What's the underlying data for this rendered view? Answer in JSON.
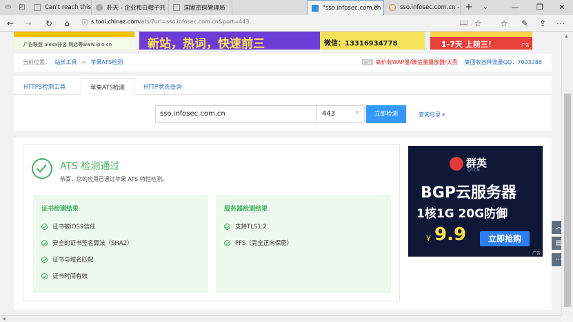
{
  "tabs": [
    {
      "title": "Can't reach this page"
    },
    {
      "title": "朴天 - 企业和白帽子共"
    },
    {
      "title": "国家密码管理局"
    },
    {
      "title": "\"sso.infosec.com.cn"
    },
    {
      "title": "sso.infosec.com.cn - SS"
    }
  ],
  "address": {
    "host": "s.tool.chinaz.com",
    "path": "/ats/?url=sso.infosec.com.cn&port=443"
  },
  "banners": {
    "left_text": "广告联盟 alexa排名 网店等www.iplo.cn",
    "middle_big": "新站，热词，快速前三",
    "middle_contact": "微信：13316934778",
    "right_big": "1-7天 上前三！",
    "right_tag": "广告"
  },
  "breadcrumb": {
    "prefix": "当前位置：",
    "home": "站长工具",
    "sep": ">",
    "current": "苹果ATS检测"
  },
  "promo": {
    "badge": "广告",
    "text1": "高价收WAP量/微信量播放器/大秀",
    "text2": "集团收各种流量QQ：7003288"
  },
  "tool_tabs": [
    "HTTPS检测工具",
    "苹果ATS检测",
    "HTTP状态查询"
  ],
  "search": {
    "host": "sso.infosec.com.cn",
    "port": "443",
    "button": "立即检测",
    "history": "查询记录"
  },
  "result": {
    "title": "ATS 检测通过",
    "subtitle": "恭喜，您的应用已通过苹果 ATS 特性检测。",
    "cert_title": "证书检测结果",
    "cert_items": [
      "证书被iOS9信任",
      "安全的证书签名算法（SHA2）",
      "证书与域名匹配",
      "证书时间有效"
    ],
    "server_title": "服务器检测结果",
    "server_items": [
      "支持TLS1.2",
      "PFS（完全正向保密）"
    ]
  },
  "ad": {
    "brand": "群英",
    "brand_sub": "QY.CN",
    "line1": "BGP云服务器",
    "line2": "1核1G 20G防御",
    "price_symbol": "¥",
    "price": "9.9",
    "cta": "立即抢购",
    "tag": "广告"
  },
  "colors": {
    "accent": "#3399ff",
    "success": "#45b363",
    "promo_red": "#e02020",
    "link": "#2d6fc1"
  }
}
